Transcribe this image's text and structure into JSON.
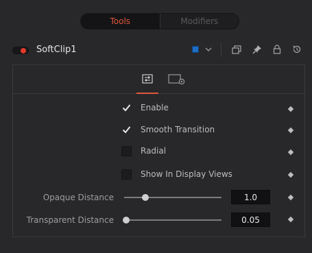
{
  "mode_tabs": {
    "tools_label": "Tools",
    "modifiers_label": "Modifiers",
    "active": "Tools"
  },
  "node": {
    "name": "SoftClip1",
    "enabled": true,
    "color": "#1d6ec4"
  },
  "header_icons": [
    "chevron-down-icon",
    "versions-icon",
    "pin-icon",
    "lock-icon",
    "reset-icon"
  ],
  "inspector_tabs": [
    {
      "icon": "controls-icon",
      "active": true
    },
    {
      "icon": "settings-icon",
      "active": false
    }
  ],
  "checkboxes": [
    {
      "label": "Enable",
      "checked": true
    },
    {
      "label": "Smooth Transition",
      "checked": true
    },
    {
      "label": "Radial",
      "checked": false
    },
    {
      "label": "Show In Display Views",
      "checked": false
    }
  ],
  "sliders": [
    {
      "label": "Opaque Distance",
      "value": "1.0",
      "position": 0.22
    },
    {
      "label": "Transparent Distance",
      "value": "0.05",
      "position": 0.02
    }
  ],
  "colors": {
    "accent": "#e2573d",
    "toggle_on": "#e2392c",
    "background": "#28282b"
  }
}
